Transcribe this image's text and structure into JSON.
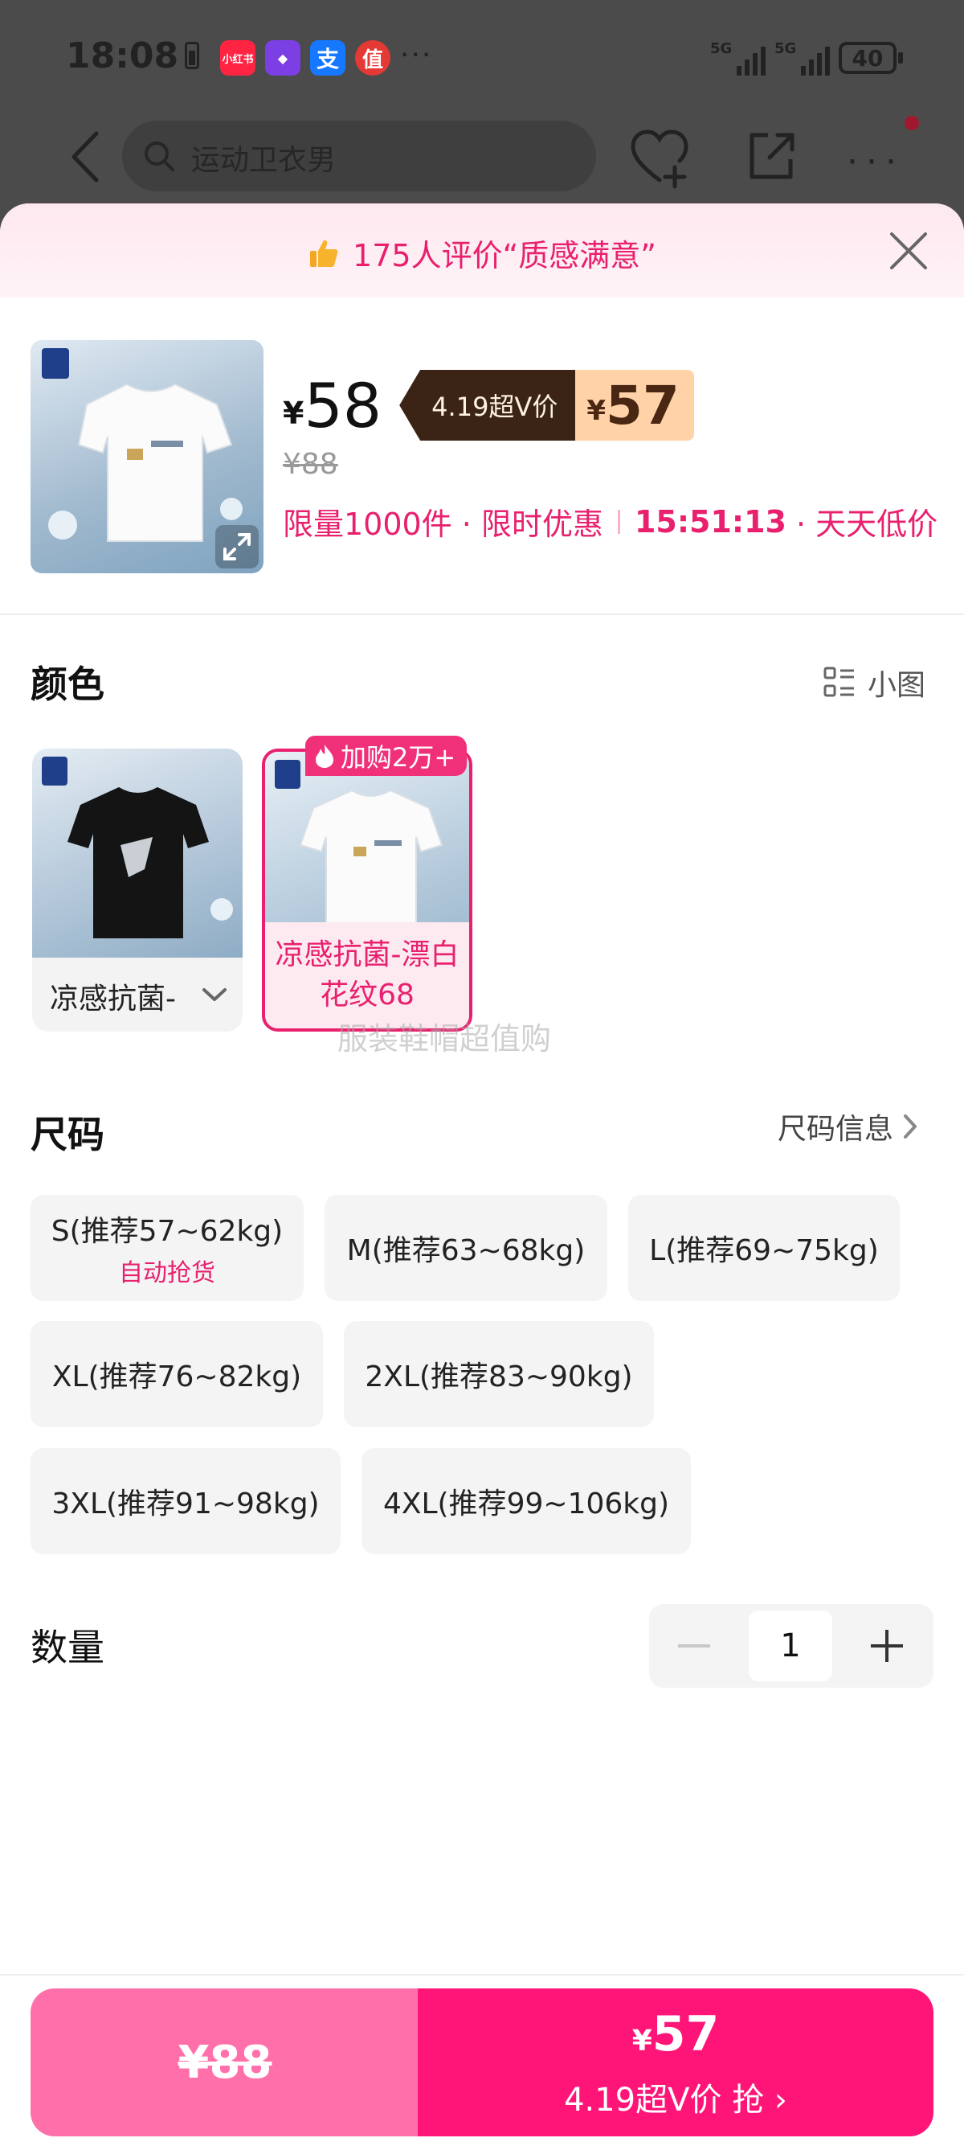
{
  "status_bar": {
    "time": "18:08",
    "apps": [
      {
        "name": "小红书",
        "color": "#ff2442"
      },
      {
        "name": "◆",
        "color": "#7b3fe4"
      },
      {
        "name": "支",
        "color": "#1677ff"
      },
      {
        "name": "值",
        "color": "#e53935"
      }
    ],
    "more": "···",
    "signal_1": "5G",
    "signal_2": "5G",
    "battery": "40"
  },
  "nav": {
    "search_placeholder": "运动卫衣男"
  },
  "banner": {
    "text": "175人评价“质感满意”"
  },
  "product": {
    "currency": "¥",
    "price": "58",
    "vip_label": "4.19超V价",
    "vip_currency": "¥",
    "vip_price": "57",
    "original_price": "¥88",
    "promo_limit": "限量1000件 · 限时优惠",
    "countdown": "15:51:13",
    "promo_tail": "· 天天低价"
  },
  "color_section": {
    "title": "颜色",
    "view_toggle": "小图",
    "options": [
      {
        "label": "凉感抗菌-"
      },
      {
        "label": "凉感抗菌-漂白花纹68",
        "badge": "加购2万+"
      }
    ]
  },
  "watermark": "服装鞋帽超值购",
  "size_section": {
    "title": "尺码",
    "info_link": "尺码信息",
    "sizes": [
      {
        "label": "S(推荐57~62kg)",
        "sub": "自动抢货"
      },
      {
        "label": "M(推荐63~68kg)"
      },
      {
        "label": "L(推荐69~75kg)"
      },
      {
        "label": "XL(推荐76~82kg)"
      },
      {
        "label": "2XL(推荐83~90kg)"
      },
      {
        "label": "3XL(推荐91~98kg)"
      },
      {
        "label": "4XL(推荐99~106kg)"
      }
    ]
  },
  "quantity": {
    "title": "数量",
    "value": "1"
  },
  "footer": {
    "original_button": "¥88",
    "buy_currency": "¥",
    "buy_price": "57",
    "buy_label": "4.19超V价 抢 ›"
  },
  "colors": {
    "accent": "#e8206e",
    "buy_button": "#ff1478",
    "original_button": "#ff70ab",
    "vip_tag_dark": "#3b2415",
    "vip_tag_light": "#ffd2a8"
  }
}
